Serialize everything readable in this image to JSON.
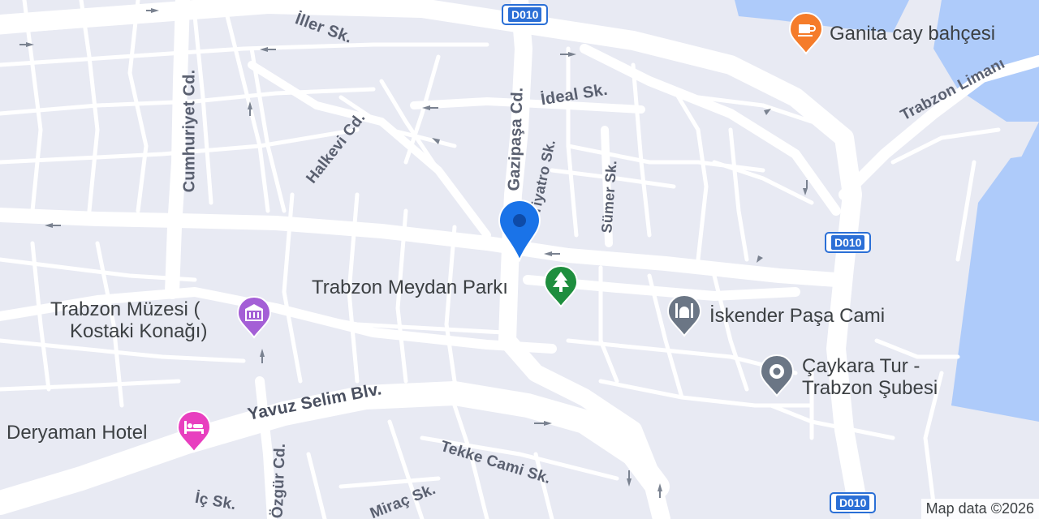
{
  "map": {
    "attribution": "Map data ©2026",
    "colors": {
      "land": "#e8eaf3",
      "road": "#ffffff",
      "water": "#aecbfa",
      "arrow": "#7a8290",
      "location": "#1a73e8"
    },
    "streets": [
      {
        "id": "iller",
        "text": "İller Sk."
      },
      {
        "id": "cumhuriyet",
        "text": "Cumhuriyet Cd."
      },
      {
        "id": "halkevi",
        "text": "Halkevi Cd."
      },
      {
        "id": "gazipasa",
        "text": "Gazipaşa Cd."
      },
      {
        "id": "tiyatro",
        "text": "Tiyatro Sk."
      },
      {
        "id": "ideal",
        "text": "İdeal Sk."
      },
      {
        "id": "sumer",
        "text": "Sümer Sk."
      },
      {
        "id": "liman",
        "text": "Trabzon Limanı"
      },
      {
        "id": "yavuz",
        "text": "Yavuz Selim Blv."
      },
      {
        "id": "tekke",
        "text": "Tekke Cami Sk."
      },
      {
        "id": "mirac",
        "text": "Miraç Sk."
      },
      {
        "id": "ozgur",
        "text": "Özgür Cd."
      },
      {
        "id": "ic",
        "text": "İç Sk."
      }
    ],
    "shields": [
      {
        "id": "top",
        "text": "D010"
      },
      {
        "id": "right",
        "text": "D010"
      },
      {
        "id": "bottom",
        "text": "D010"
      }
    ],
    "pois": [
      {
        "id": "ganita",
        "name": "Ganita cay bahçesi",
        "icon": "coffee-icon",
        "color": "#f57c2a"
      },
      {
        "id": "meydan",
        "name": "Trabzon Meydan Parkı",
        "icon": "tree-icon",
        "color": "#1e8e3e"
      },
      {
        "id": "muzesi",
        "name": "Trabzon Müzesi ( Kostaki Konağı)",
        "line1": "Trabzon Müzesi (",
        "line2": "Kostaki Konağı)",
        "icon": "museum-icon",
        "color": "#a45fd6"
      },
      {
        "id": "iskender",
        "name": "İskender Paşa Cami",
        "icon": "mosque-icon",
        "color": "#6b7685"
      },
      {
        "id": "caykara",
        "name": "Çaykara Tur - Trabzon Şubesi",
        "line1": "Çaykara Tur -",
        "line2": "Trabzon Şubesi",
        "icon": "place-icon",
        "color": "#6b7685"
      },
      {
        "id": "deryaman",
        "name": "Deryaman Hotel",
        "icon": "hotel-icon",
        "color": "#e83fbf"
      }
    ]
  }
}
